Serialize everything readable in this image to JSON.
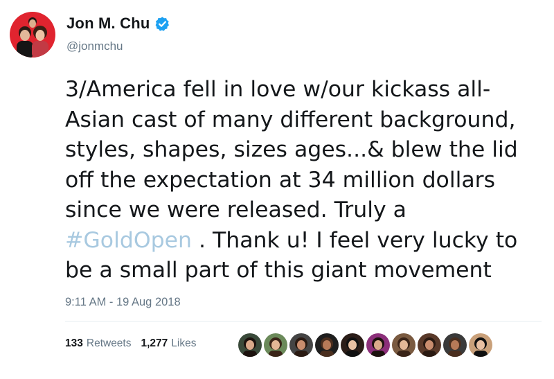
{
  "user": {
    "display_name": "Jon M. Chu",
    "handle": "@jonmchu",
    "verified_icon": "verified-badge-icon",
    "avatar_icon": "profile-avatar"
  },
  "tweet": {
    "lines": [
      "3/America fell in love w/our kickass all-",
      "Asian cast of many different background,",
      "styles, shapes, sizes ages...& blew the lid",
      "off the expectation at 34 million dollars",
      "since we were released. Truly a"
    ],
    "hashtag": "#GoldOpen",
    "after_hashtag": " . Thank u! I feel very lucky to",
    "last_line": "be a small part of this giant movement",
    "timestamp": "9:11 AM - 19 Aug 2018"
  },
  "stats": {
    "retweets_count": "133",
    "retweets_label": "Retweets",
    "likes_count": "1,277",
    "likes_label": "Likes"
  },
  "colors": {
    "text": "#14171a",
    "secondary": "#657786",
    "hashtag": "#a8c9e0",
    "verified": "#1da1f2"
  },
  "likers": [
    {
      "icon": "liker-avatar-1",
      "color": "#3a4a3a"
    },
    {
      "icon": "liker-avatar-2",
      "color": "#6b8a5a"
    },
    {
      "icon": "liker-avatar-3",
      "color": "#444444"
    },
    {
      "icon": "liker-avatar-4",
      "color": "#1e1e1e"
    },
    {
      "icon": "liker-avatar-5",
      "color": "#2b1d18"
    },
    {
      "icon": "liker-avatar-6",
      "color": "#8c2f7a"
    },
    {
      "icon": "liker-avatar-7",
      "color": "#7a5a40"
    },
    {
      "icon": "liker-avatar-8",
      "color": "#5a3a2a"
    },
    {
      "icon": "liker-avatar-9",
      "color": "#3a3a3a"
    },
    {
      "icon": "liker-avatar-10",
      "color": "#c9a07a"
    }
  ]
}
